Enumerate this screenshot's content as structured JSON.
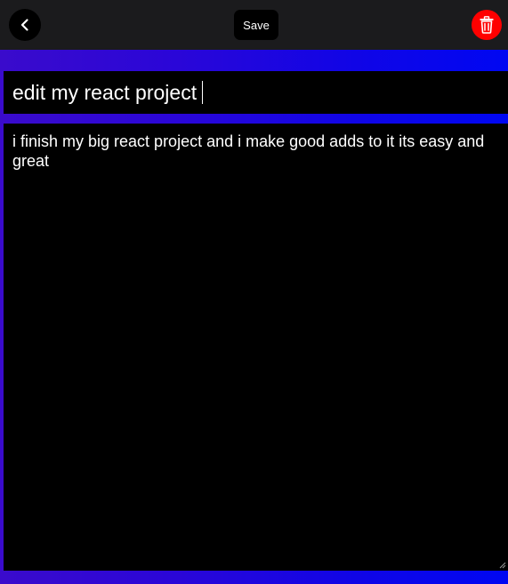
{
  "toolbar": {
    "back_icon": "chevron-left-icon",
    "save_label": "Save",
    "delete_icon": "trash-icon"
  },
  "note": {
    "title": "edit my react project",
    "body": "i finish my big react project and i make good adds to it its easy and great"
  },
  "colors": {
    "topbar": "#1b1b1d",
    "delete_button": "#ff0000",
    "gradient_start": "#3a0bcc",
    "gradient_end": "#0007f2",
    "field_background": "#000000",
    "text": "#ffffff"
  }
}
